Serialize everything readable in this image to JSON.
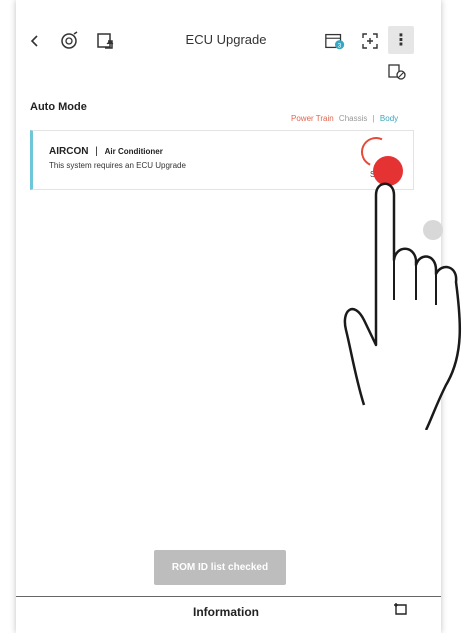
{
  "header": {
    "title": "ECU Upgrade",
    "back_icon": "back-arrow-icon",
    "vin_icon": "vehicle-scan-icon",
    "upload_icon": "upload-ecu-icon",
    "calendar_icon": "calendar-sync-icon",
    "scan_icon": "scan-add-icon",
    "more_icon": "more-vertical-icon",
    "sub_icon": "vehicle-settings-icon"
  },
  "section": {
    "mode": "Auto Mode",
    "filters": [
      "Power Train",
      "Chassis",
      "Body"
    ]
  },
  "card": {
    "code": "AIRCON",
    "separator": "|",
    "name": "Air Conditioner",
    "description": "This system requires an ECU Upgrade",
    "status": "Se"
  },
  "buttons": {
    "rom_checked": "ROM ID list checked"
  },
  "footer": {
    "information": "Information",
    "expand_icon": "expand-icon"
  },
  "colors": {
    "accent_red": "#e53232",
    "accent_teal": "#6fc6d8",
    "filter_orange": "#e0664f",
    "filter_blue": "#38a7c2"
  }
}
